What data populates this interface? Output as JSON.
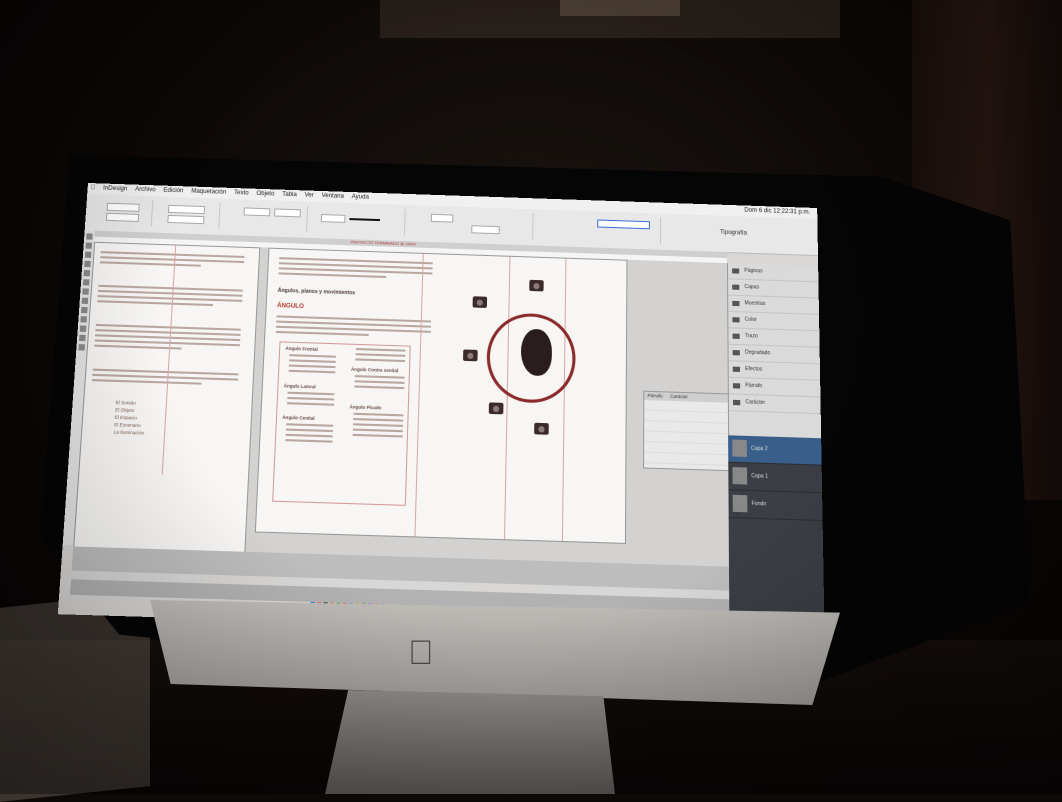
{
  "menu": {
    "items": [
      "InDesign",
      "Archivo",
      "Edición",
      "Maquetación",
      "Texto",
      "Objeto",
      "Tabla",
      "Ver",
      "Ventana",
      "Ayuda"
    ],
    "clock": "Dom 6 dic  12:22:31 p.m."
  },
  "workspace": "Tipografía",
  "document_tab": "PROYECTO TERMINADO @ 100%",
  "document": {
    "heading": "Ángulos, planos y movimientos",
    "subheading": "ÁNGULO",
    "bullets": [
      "Ángulo Frontal",
      "Ángulo Lateral",
      "Ángulo Cenital",
      "Ángulo Contra cenital",
      "Ángulo Picado"
    ],
    "left_list": [
      "El Sonido",
      "El Objeto",
      "El Espacio",
      "El Escenario",
      "La Iluminación"
    ]
  },
  "panels": {
    "items": [
      "Páginas",
      "Capas",
      "Muestras",
      "Color",
      "Trazo",
      "Degradado",
      "Efectos",
      "Párrafo",
      "Carácter"
    ]
  },
  "char_panel": {
    "tabs": [
      "Párrafo",
      "Carácter"
    ]
  },
  "layers": [
    "Capa 2",
    "Capa 1",
    "Fondo"
  ],
  "colors": {
    "accent": "#b73a2a",
    "circle": "#8b2a2a",
    "layer_sel": "#3a5e8a"
  }
}
